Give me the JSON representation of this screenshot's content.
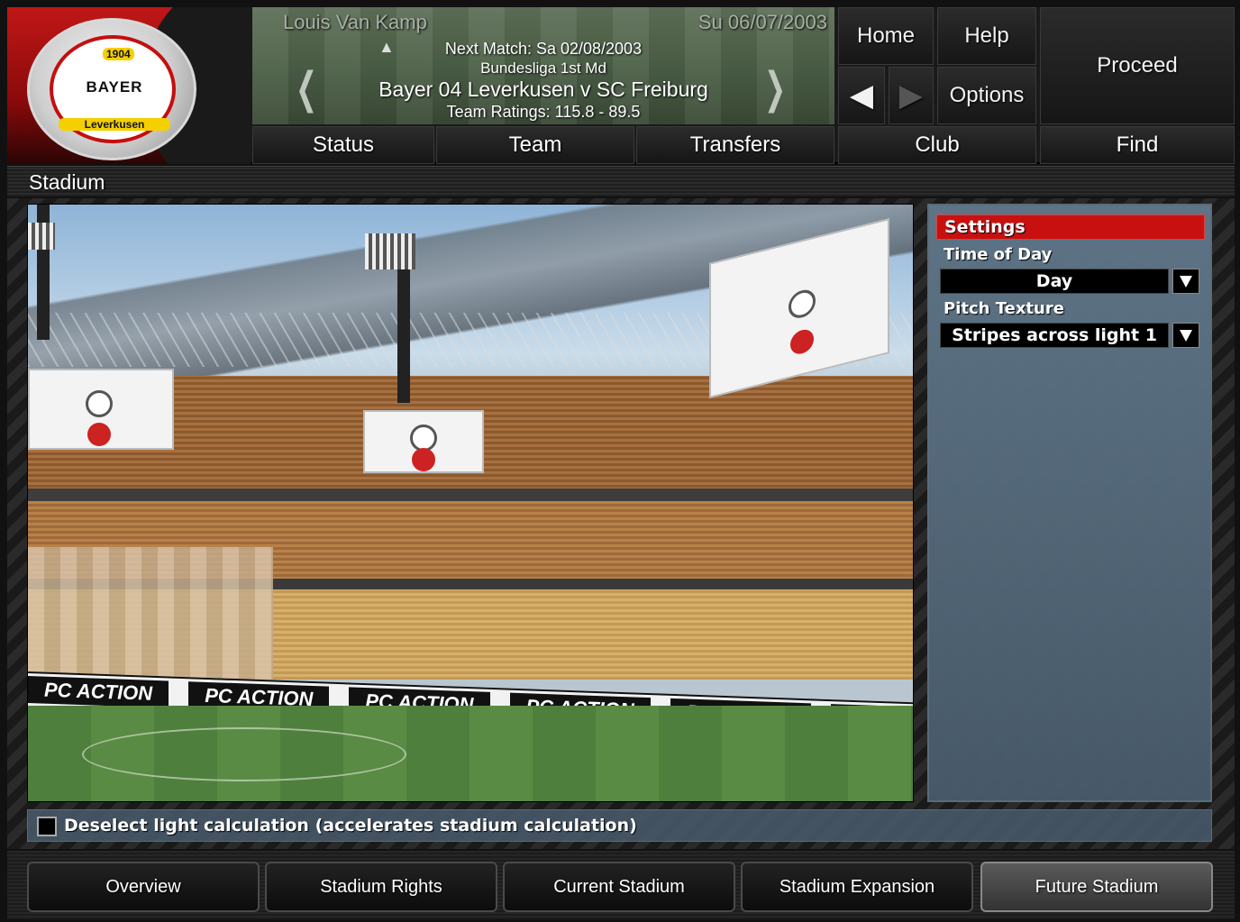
{
  "header": {
    "manager_name": "Louis Van Kamp",
    "game_date": "Su 06/07/2003",
    "next_match": "Next Match: Sa 02/08/2003",
    "competition": "Bundesliga 1st Md",
    "fixture": "Bayer 04 Leverkusen v SC Freiburg",
    "team_ratings": "Team Ratings: 115.8 - 89.5",
    "logo": {
      "year": "1904",
      "name": "BAYER",
      "city": "Leverkusen"
    },
    "buttons": {
      "home": "Home",
      "help": "Help",
      "options": "Options",
      "proceed": "Proceed"
    },
    "tabs": {
      "status": "Status",
      "team": "Team",
      "transfers": "Transfers",
      "club": "Club",
      "find": "Find"
    }
  },
  "page_title": "Stadium",
  "settings": {
    "header": "Settings",
    "time_of_day_label": "Time of Day",
    "time_of_day_value": "Day",
    "pitch_texture_label": "Pitch Texture",
    "pitch_texture_value": "Stripes across light 1"
  },
  "light_calculation": {
    "label": "Deselect light calculation (accelerates stadium calculation)",
    "checked": false
  },
  "viewport": {
    "ad_text": "PC ACTION"
  },
  "bottom_tabs": {
    "overview": "Overview",
    "stadium_rights": "Stadium Rights",
    "current_stadium": "Current Stadium",
    "stadium_expansion": "Stadium Expansion",
    "future_stadium": "Future Stadium",
    "active": "future_stadium"
  },
  "colors": {
    "accent_red": "#c81010",
    "panel_blue": "#586e80"
  }
}
